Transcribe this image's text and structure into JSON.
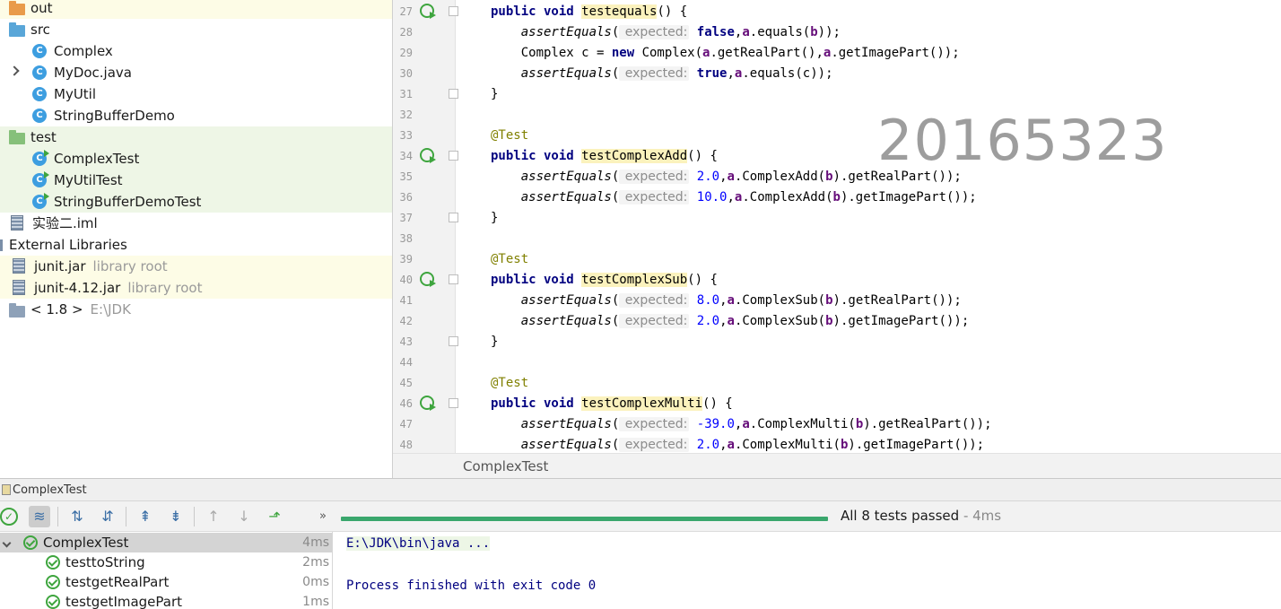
{
  "project_tree": {
    "items": [
      {
        "label": "out",
        "type": "folder",
        "color": "#e99b4a"
      },
      {
        "label": "src",
        "type": "folder",
        "color": "#59a6d8"
      },
      {
        "label": "Complex",
        "type": "class"
      },
      {
        "label": "MyDoc.java",
        "type": "class"
      },
      {
        "label": "MyUtil",
        "type": "class"
      },
      {
        "label": "StringBufferDemo",
        "type": "class"
      },
      {
        "label": "test",
        "type": "folder",
        "color": "#86c07a"
      },
      {
        "label": "ComplexTest",
        "type": "class"
      },
      {
        "label": "MyUtilTest",
        "type": "class"
      },
      {
        "label": "StringBufferDemoTest",
        "type": "class"
      },
      {
        "label": "实验二.iml",
        "type": "file"
      },
      {
        "label": "External Libraries",
        "type": "group"
      },
      {
        "label": "junit.jar",
        "hint": "library root",
        "type": "jar"
      },
      {
        "label": "junit-4.12.jar",
        "hint": "library root",
        "type": "jar"
      },
      {
        "label": "< 1.8 >",
        "hint": "E:\\JDK",
        "type": "jdk"
      }
    ]
  },
  "editor": {
    "lines": [
      {
        "n": "27",
        "tokens": [
          {
            "t": "public void ",
            "c": "kw"
          },
          {
            "t": "testequals",
            "c": "hl"
          },
          {
            "t": "() {"
          }
        ]
      },
      {
        "n": "28",
        "tokens": [
          {
            "t": "    "
          },
          {
            "t": "assertEquals",
            "c": "fn"
          },
          {
            "t": "("
          },
          {
            "t": " expected:",
            "c": "ph"
          },
          {
            "t": " "
          },
          {
            "t": "false",
            "c": "kw"
          },
          {
            "t": ","
          },
          {
            "t": "a",
            "c": "fld"
          },
          {
            "t": ".equals("
          },
          {
            "t": "b",
            "c": "fld"
          },
          {
            "t": "));"
          }
        ]
      },
      {
        "n": "29",
        "tokens": [
          {
            "t": "    Complex c = "
          },
          {
            "t": "new ",
            "c": "kw"
          },
          {
            "t": "Complex("
          },
          {
            "t": "a",
            "c": "fld"
          },
          {
            "t": ".getRealPart(),"
          },
          {
            "t": "a",
            "c": "fld"
          },
          {
            "t": ".getImagePart());"
          }
        ]
      },
      {
        "n": "30",
        "tokens": [
          {
            "t": "    "
          },
          {
            "t": "assertEquals",
            "c": "fn"
          },
          {
            "t": "("
          },
          {
            "t": " expected:",
            "c": "ph"
          },
          {
            "t": " "
          },
          {
            "t": "true",
            "c": "kw"
          },
          {
            "t": ","
          },
          {
            "t": "a",
            "c": "fld"
          },
          {
            "t": ".equals(c));"
          }
        ]
      },
      {
        "n": "31",
        "tokens": [
          {
            "t": "}"
          }
        ]
      },
      {
        "n": "32",
        "tokens": []
      },
      {
        "n": "33",
        "tokens": [
          {
            "t": "@Test",
            "c": "ann"
          }
        ]
      },
      {
        "n": "34",
        "tokens": [
          {
            "t": "public void ",
            "c": "kw"
          },
          {
            "t": "testComplexAdd",
            "c": "hl"
          },
          {
            "t": "() {"
          }
        ]
      },
      {
        "n": "35",
        "tokens": [
          {
            "t": "    "
          },
          {
            "t": "assertEquals",
            "c": "fn"
          },
          {
            "t": "("
          },
          {
            "t": " expected:",
            "c": "ph"
          },
          {
            "t": " "
          },
          {
            "t": "2.0",
            "c": "num"
          },
          {
            "t": ","
          },
          {
            "t": "a",
            "c": "fld"
          },
          {
            "t": ".ComplexAdd("
          },
          {
            "t": "b",
            "c": "fld"
          },
          {
            "t": ").getRealPart());"
          }
        ]
      },
      {
        "n": "36",
        "tokens": [
          {
            "t": "    "
          },
          {
            "t": "assertEquals",
            "c": "fn"
          },
          {
            "t": "("
          },
          {
            "t": " expected:",
            "c": "ph"
          },
          {
            "t": " "
          },
          {
            "t": "10.0",
            "c": "num"
          },
          {
            "t": ","
          },
          {
            "t": "a",
            "c": "fld"
          },
          {
            "t": ".ComplexAdd("
          },
          {
            "t": "b",
            "c": "fld"
          },
          {
            "t": ").getImagePart());"
          }
        ]
      },
      {
        "n": "37",
        "tokens": [
          {
            "t": "}"
          }
        ]
      },
      {
        "n": "38",
        "tokens": []
      },
      {
        "n": "39",
        "tokens": [
          {
            "t": "@Test",
            "c": "ann"
          }
        ]
      },
      {
        "n": "40",
        "tokens": [
          {
            "t": "public void ",
            "c": "kw"
          },
          {
            "t": "testComplexSub",
            "c": "hl"
          },
          {
            "t": "() {"
          }
        ]
      },
      {
        "n": "41",
        "tokens": [
          {
            "t": "    "
          },
          {
            "t": "assertEquals",
            "c": "fn"
          },
          {
            "t": "("
          },
          {
            "t": " expected:",
            "c": "ph"
          },
          {
            "t": " "
          },
          {
            "t": "8.0",
            "c": "num"
          },
          {
            "t": ","
          },
          {
            "t": "a",
            "c": "fld"
          },
          {
            "t": ".ComplexSub("
          },
          {
            "t": "b",
            "c": "fld"
          },
          {
            "t": ").getRealPart());"
          }
        ]
      },
      {
        "n": "42",
        "tokens": [
          {
            "t": "    "
          },
          {
            "t": "assertEquals",
            "c": "fn"
          },
          {
            "t": "("
          },
          {
            "t": " expected:",
            "c": "ph"
          },
          {
            "t": " "
          },
          {
            "t": "2.0",
            "c": "num"
          },
          {
            "t": ","
          },
          {
            "t": "a",
            "c": "fld"
          },
          {
            "t": ".ComplexSub("
          },
          {
            "t": "b",
            "c": "fld"
          },
          {
            "t": ").getImagePart());"
          }
        ]
      },
      {
        "n": "43",
        "tokens": [
          {
            "t": "}"
          }
        ]
      },
      {
        "n": "44",
        "tokens": []
      },
      {
        "n": "45",
        "tokens": [
          {
            "t": "@Test",
            "c": "ann"
          }
        ]
      },
      {
        "n": "46",
        "tokens": [
          {
            "t": "public void ",
            "c": "kw"
          },
          {
            "t": "testComplexMulti",
            "c": "hl"
          },
          {
            "t": "() {"
          }
        ]
      },
      {
        "n": "47",
        "tokens": [
          {
            "t": "    "
          },
          {
            "t": "assertEquals",
            "c": "fn"
          },
          {
            "t": "("
          },
          {
            "t": " expected:",
            "c": "ph"
          },
          {
            "t": " "
          },
          {
            "t": "-39.0",
            "c": "num"
          },
          {
            "t": ","
          },
          {
            "t": "a",
            "c": "fld"
          },
          {
            "t": ".ComplexMulti("
          },
          {
            "t": "b",
            "c": "fld"
          },
          {
            "t": ").getRealPart());"
          }
        ]
      },
      {
        "n": "48",
        "tokens": [
          {
            "t": "    "
          },
          {
            "t": "assertEquals",
            "c": "fn"
          },
          {
            "t": "("
          },
          {
            "t": " expected:",
            "c": "ph"
          },
          {
            "t": " "
          },
          {
            "t": "2.0",
            "c": "num"
          },
          {
            "t": ","
          },
          {
            "t": "a",
            "c": "fld"
          },
          {
            "t": ".ComplexMulti("
          },
          {
            "t": "b",
            "c": "fld"
          },
          {
            "t": ").getImagePart());"
          }
        ]
      }
    ],
    "run_gutter_lines": [
      "27",
      "34",
      "40",
      "46"
    ],
    "watermark": "20165323",
    "breadcrumb": "ComplexTest"
  },
  "run_panel": {
    "title": "ComplexTest",
    "status": "All 8 tests passed",
    "duration": " - 4ms",
    "progress_fraction": 1.0,
    "tests": [
      {
        "name": "ComplexTest",
        "time": "4ms",
        "root": true
      },
      {
        "name": "testtoString",
        "time": "2ms"
      },
      {
        "name": "testgetRealPart",
        "time": "0ms"
      },
      {
        "name": "testgetImagePart",
        "time": "1ms"
      }
    ],
    "console": {
      "cmd": "E:\\JDK\\bin\\java ...",
      "exit": "Process finished with exit code 0"
    }
  }
}
